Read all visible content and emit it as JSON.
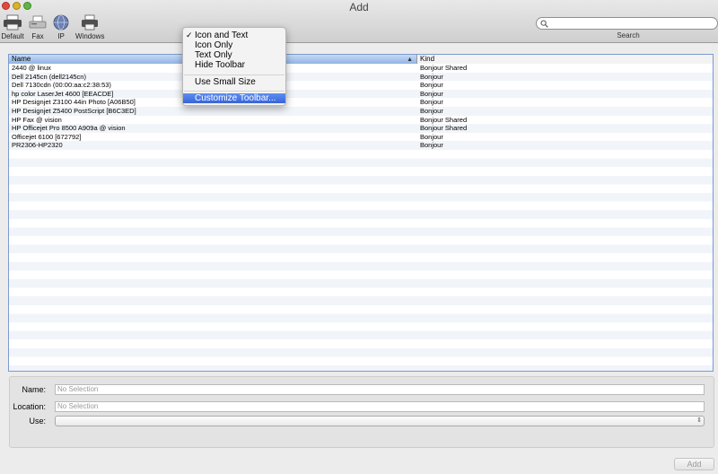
{
  "window": {
    "title": "Add"
  },
  "toolbar": {
    "items": [
      {
        "label": "Default",
        "icon": "printer-icon"
      },
      {
        "label": "Fax",
        "icon": "fax-icon"
      },
      {
        "label": "IP",
        "icon": "globe-icon"
      },
      {
        "label": "Windows",
        "icon": "windows-printer-icon"
      }
    ],
    "search_label": "Search",
    "search_placeholder": ""
  },
  "context_menu": {
    "items": [
      {
        "label": "Icon and Text",
        "checked": true
      },
      {
        "label": "Icon Only"
      },
      {
        "label": "Text Only"
      },
      {
        "label": "Hide Toolbar"
      },
      {
        "label": "Use Small Size"
      },
      {
        "label": "Customize Toolbar...",
        "highlighted": true
      }
    ]
  },
  "printer_table": {
    "columns": [
      "Name",
      "Kind"
    ],
    "rows": [
      [
        "2440 @ linux",
        "Bonjour Shared"
      ],
      [
        "Dell 2145cn (dell2145cn)",
        "Bonjour"
      ],
      [
        "Dell 7130cdn (00:00:aa:c2:38:53)",
        "Bonjour"
      ],
      [
        "hp color LaserJet 4600 [EEACDE]",
        "Bonjour"
      ],
      [
        "HP Designjet Z3100 44in Photo [A06B50]",
        "Bonjour"
      ],
      [
        "HP Designjet Z5400 PostScript [B6C3ED]",
        "Bonjour"
      ],
      [
        "HP Fax @ vision",
        "Bonjour Shared"
      ],
      [
        "HP Officejet Pro 8500 A909a @ vision",
        "Bonjour Shared"
      ],
      [
        "Officejet 6100 [672792]",
        "Bonjour"
      ],
      [
        "PR2306-HP2320",
        "Bonjour"
      ]
    ]
  },
  "details": {
    "name_label": "Name:",
    "name_placeholder": "No Selection",
    "location_label": "Location:",
    "location_placeholder": "No Selection",
    "use_label": "Use:",
    "use_value": ""
  },
  "buttons": {
    "add_label": "Add"
  },
  "colors": {
    "header_selected": "#91b4e4",
    "menu_highlight": "#3864d8",
    "table_border": "#7c9bd1"
  }
}
